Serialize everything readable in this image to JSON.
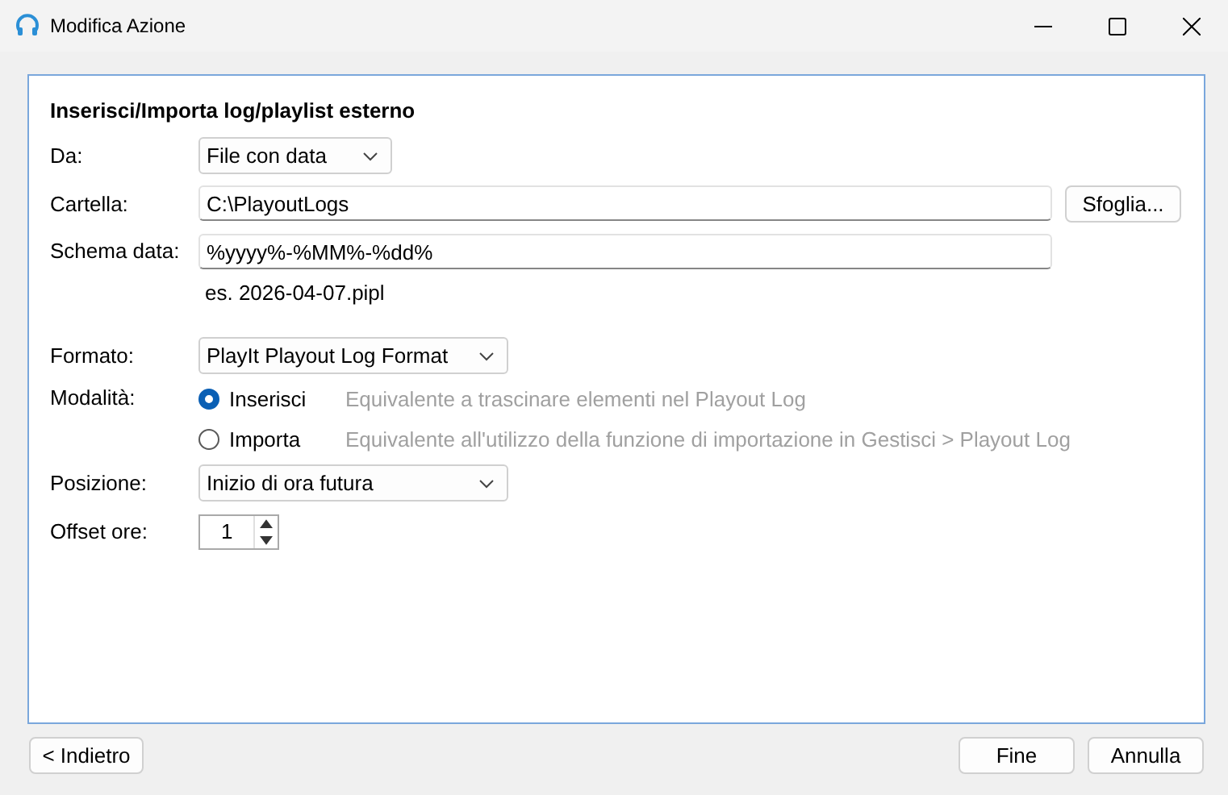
{
  "window": {
    "title": "Modifica Azione"
  },
  "heading": "Inserisci/Importa log/playlist esterno",
  "rows": [
    {
      "kind": "select",
      "label": "Da:",
      "value": "File con data"
    },
    {
      "kind": "text",
      "label": "Cartella:",
      "value": "C:\\PlayoutLogs",
      "button": "Sfoglia..."
    },
    {
      "kind": "text",
      "label": "Schema data:",
      "value": "%yyyy%-%MM%-%dd%",
      "hint": "es. 2026-04-07.pipl"
    },
    {
      "kind": "select",
      "label": "Formato:",
      "value": "PlayIt Playout Log Format"
    },
    {
      "kind": "radio",
      "label": "Modalità:",
      "options": [
        {
          "label": "Inserisci",
          "description": "Equivalente a trascinare elementi nel Playout Log",
          "selected": true
        },
        {
          "label": "Importa",
          "description": "Equivalente all'utilizzo della funzione di importazione in Gestisci > Playout Log",
          "selected": false
        }
      ]
    },
    {
      "kind": "select",
      "label": "Posizione:",
      "value": "Inizio di ora futura"
    },
    {
      "kind": "spinner",
      "label": "Offset ore:",
      "value": "1"
    }
  ],
  "footer": {
    "left": [
      "< Indietro"
    ],
    "right": [
      "Fine",
      "Annulla"
    ]
  }
}
